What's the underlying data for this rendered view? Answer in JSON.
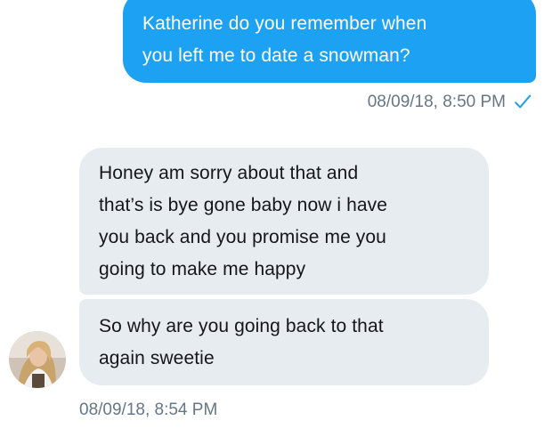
{
  "messages": {
    "sent_1": {
      "lines": [
        "Katherine do you remember when",
        "you left me to date a snowman?"
      ],
      "timestamp": "08/09/18, 8:50 PM",
      "status_icon": "checkmark-icon"
    },
    "received_1": {
      "lines": [
        "Honey am sorry about that and",
        "that’s is bye gone baby now i have",
        "you back and you promise me you",
        "going to make me happy"
      ]
    },
    "received_2": {
      "lines": [
        "So why are you going back to that",
        "again sweetie"
      ],
      "timestamp": "08/09/18, 8:54 PM"
    }
  },
  "colors": {
    "sent_bubble": "#1da1f2",
    "received_bubble": "#e6ecf0",
    "timestamp_text": "#657786"
  }
}
